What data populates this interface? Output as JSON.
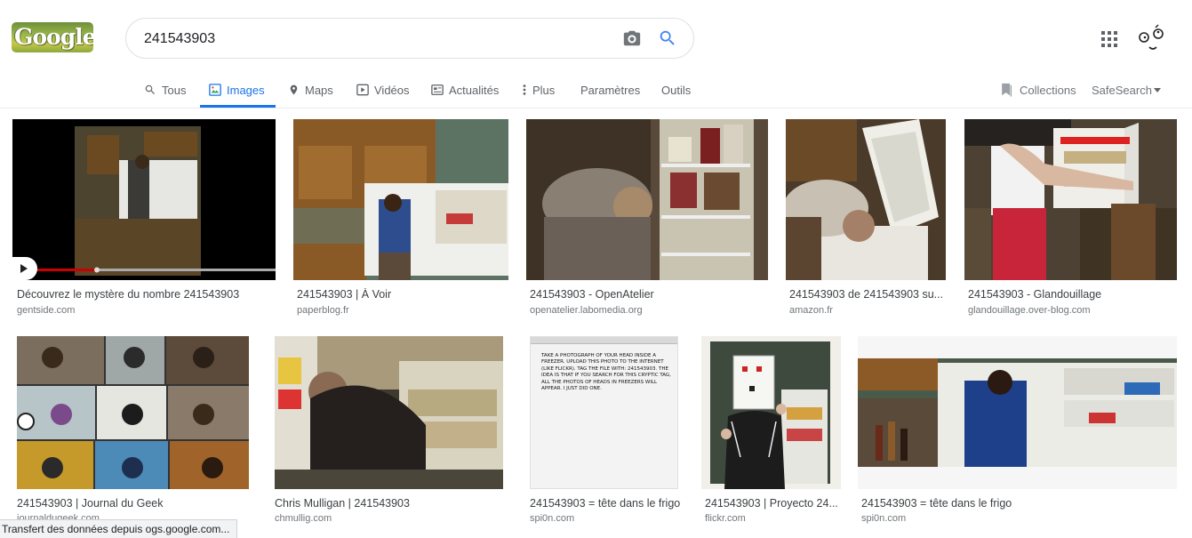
{
  "logo": {
    "text": "Google"
  },
  "search": {
    "query": "241543903",
    "placeholder": ""
  },
  "tabs": [
    {
      "label": "Tous",
      "icon": "search-icon"
    },
    {
      "label": "Images",
      "icon": "image-icon",
      "active": true
    },
    {
      "label": "Maps",
      "icon": "map-pin-icon"
    },
    {
      "label": "Vidéos",
      "icon": "play-icon"
    },
    {
      "label": "Actualités",
      "icon": "news-icon"
    },
    {
      "label": "Plus",
      "icon": "more-vertical-icon"
    },
    {
      "label": "Paramètres"
    },
    {
      "label": "Outils"
    }
  ],
  "tools": {
    "collections": "Collections",
    "safesearch": "SafeSearch"
  },
  "results": [
    {
      "caption": "Découvrez le mystère du nombre 241543903",
      "domain": "gentside.com"
    },
    {
      "caption": "241543903 | À Voir",
      "domain": "paperblog.fr"
    },
    {
      "caption": "241543903 - OpenAtelier",
      "domain": "openatelier.labomedia.org"
    },
    {
      "caption": "241543903 de 241543903 su...",
      "domain": "amazon.fr"
    },
    {
      "caption": "241543903 - Glandouillage",
      "domain": "glandouillage.over-blog.com"
    },
    {
      "caption": "241543903 | Journal du Geek",
      "domain": "journaldugeek.com"
    },
    {
      "caption": "Chris Mulligan | 241543903",
      "domain": "chmullig.com"
    },
    {
      "caption": "241543903 = tête dans le frigo",
      "domain": "spi0n.com"
    },
    {
      "caption": "241543903 | Proyecto 24...",
      "domain": "flickr.com"
    },
    {
      "caption": "241543903 = tête dans le frigo",
      "domain": "spi0n.com"
    }
  ],
  "note_image": "TAKE A PHOTOGRAPH OF YOUR HEAD INSIDE A FREEZER. UPLOAD THIS PHOTO TO THE INTERNET (LIKE FLICKR). TAG THE FILE WITH: 241543903. THE IDEA IS THAT IF YOU SEARCH FOR THIS CRYPTIC TAG, ALL THE PHOTOS OF HEADS IN FREEZERS WILL APPEAR. I JUST DID ONE.",
  "status_bar": "Transfert des données depuis ogs.google.com...",
  "colors": {
    "accent": "#1a73e8",
    "text_secondary": "#70757a"
  }
}
